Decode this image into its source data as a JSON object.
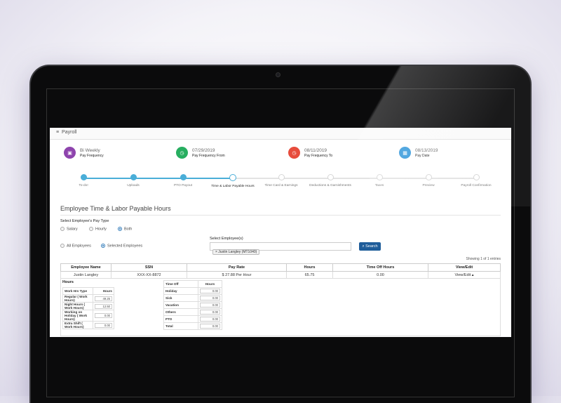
{
  "window": {
    "title": "Payroll"
  },
  "summary": [
    {
      "value": "Bi Weekly",
      "label": "Pay Frequency",
      "icon": "money-icon",
      "color": "#8e44ad"
    },
    {
      "value": "07/29/2019",
      "label": "Pay Frequency From",
      "icon": "clock-icon",
      "color": "#27ae60"
    },
    {
      "value": "08/11/2019",
      "label": "Pay Frequency To",
      "icon": "clock-icon",
      "color": "#e74c3c"
    },
    {
      "value": "08/13/2019",
      "label": "Pay Date",
      "icon": "calendar-icon",
      "color": "#3498db"
    }
  ],
  "steps": [
    {
      "label": "To-do!"
    },
    {
      "label": "Uploads"
    },
    {
      "label": "PTO Payout"
    },
    {
      "label": "Time & Labor Payable Hours"
    },
    {
      "label": "Time Card & Earnings"
    },
    {
      "label": "Deductions & Garnishments"
    },
    {
      "label": "Taxes"
    },
    {
      "label": "Preview"
    },
    {
      "label": "Payroll Confirmation"
    }
  ],
  "section_title": "Employee Time & Labor Payable Hours",
  "pay_type": {
    "label": "Select Employee's Pay Type",
    "options": [
      "Salary",
      "Hourly",
      "Both"
    ],
    "selected": "Both"
  },
  "employee_scope": {
    "options": [
      "All Employees",
      "Selected Employees"
    ],
    "selected": "Selected Employees"
  },
  "employee_select": {
    "label": "Select Employee(s)",
    "tag": "× Justin Langley (MT1040)"
  },
  "search_button": "Search",
  "showing": "Showing 1 of 1 entries",
  "table": {
    "headers": [
      "Employee Name",
      "SSN",
      "Pay Rate",
      "Hours",
      "Time Off Hours",
      "View/Edit"
    ],
    "row": {
      "name": "Justin Langley",
      "ssn": "XXX-XX-8872",
      "rate": "$ 27.88 Per Hour",
      "hours": "65.75",
      "timeoff": "0.00",
      "action": "View/Edit ▴"
    }
  },
  "hours_detail": {
    "title": "Hours",
    "col1": "Work Hrs Type",
    "col2": "Hours",
    "rows": [
      {
        "type": "Regular ( Work Hours)",
        "val": "49.25"
      },
      {
        "type": "Night Hours ( Work Hours)",
        "val": "12.50"
      },
      {
        "type": "Working on Holiday ( Work Hours)",
        "val": "0.00"
      },
      {
        "type": "Extra Shift ( Work Hours)",
        "val": "0.00"
      }
    ]
  },
  "timeoff_detail": {
    "col1": "Time Off",
    "col2": "Hours",
    "rows": [
      {
        "type": "Holiday",
        "val": "0.00"
      },
      {
        "type": "Sick",
        "val": "0.00"
      },
      {
        "type": "Vacation",
        "val": "0.00"
      },
      {
        "type": "Others",
        "val": "0.00"
      },
      {
        "type": "PTO",
        "val": "0.00"
      },
      {
        "type": "Total",
        "val": "0.00"
      }
    ]
  }
}
